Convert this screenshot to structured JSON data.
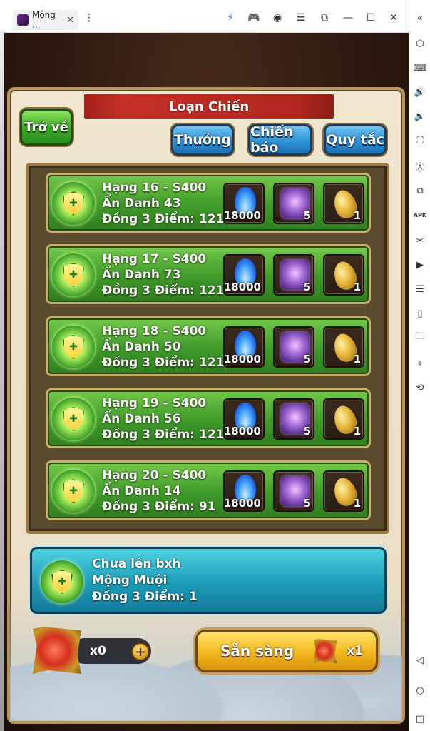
{
  "emulator": {
    "tab_title": "Mộng ...",
    "tab_close": "✕",
    "toolbar_icons": [
      "bolt-icon",
      "gamepad-icon",
      "account-icon",
      "menu-icon",
      "external-window-icon",
      "minimize-icon",
      "maximize-icon",
      "close-icon",
      "collapse-sidebar-icon"
    ],
    "sidebar_icons": [
      "settings-hex-icon",
      "keyboard-icon",
      "volume-up-icon",
      "volume-down-icon",
      "screenshot-icon",
      "auto-icon",
      "multi-instance-icon",
      "apk-icon",
      "scissors-icon",
      "record-icon",
      "macro-icon",
      "shake-icon",
      "folder-icon",
      "location-icon",
      "rotate-icon",
      "back-triangle-icon",
      "home-circle-icon",
      "recent-square-icon"
    ]
  },
  "game": {
    "title": "Loạn Chiến",
    "back_label": "Trở về",
    "tabs": [
      "Thưởng",
      "Chiến báo",
      "Quy tắc"
    ],
    "ranks": [
      {
        "line1": "Hạng 16 - S400",
        "line2": "Ẩn Danh 43",
        "line3": "Đồng 3  Điểm: 121",
        "rewards": [
          "18000",
          "5",
          "1"
        ]
      },
      {
        "line1": "Hạng 17 - S400",
        "line2": "Ẩn Danh 73",
        "line3": "Đồng 3  Điểm: 121",
        "rewards": [
          "18000",
          "5",
          "1"
        ]
      },
      {
        "line1": "Hạng 18 - S400",
        "line2": "Ẩn Danh 50",
        "line3": "Đồng 3  Điểm: 121",
        "rewards": [
          "18000",
          "5",
          "1"
        ]
      },
      {
        "line1": "Hạng 19 - S400",
        "line2": "Ẩn Danh 56",
        "line3": "Đồng 3  Điểm: 121",
        "rewards": [
          "18000",
          "5",
          "1"
        ]
      },
      {
        "line1": "Hạng 20 - S400",
        "line2": "Ẩn Danh 14",
        "line3": "Đồng 3  Điểm: 91",
        "rewards": [
          "18000",
          "5",
          "1"
        ]
      }
    ],
    "reward_icons": [
      "blue-flame-icon",
      "purple-chest-icon",
      "golden-egg-icon"
    ],
    "me": {
      "line1": "Chưa lên bxh",
      "line2": "Mộng Muội",
      "line3": "Đồng 3  Điểm: 1"
    },
    "ticket_count": "x0",
    "plus_label": "+",
    "ready_label": "Sẵn sàng",
    "ready_cost": "x1",
    "colors": {
      "rank_row": "#3f9a2a",
      "me_row": "#1c9cb8",
      "title_banner": "#c42f26",
      "blue_button": "#2b8fd4",
      "ready_button": "#f2b81e"
    }
  }
}
